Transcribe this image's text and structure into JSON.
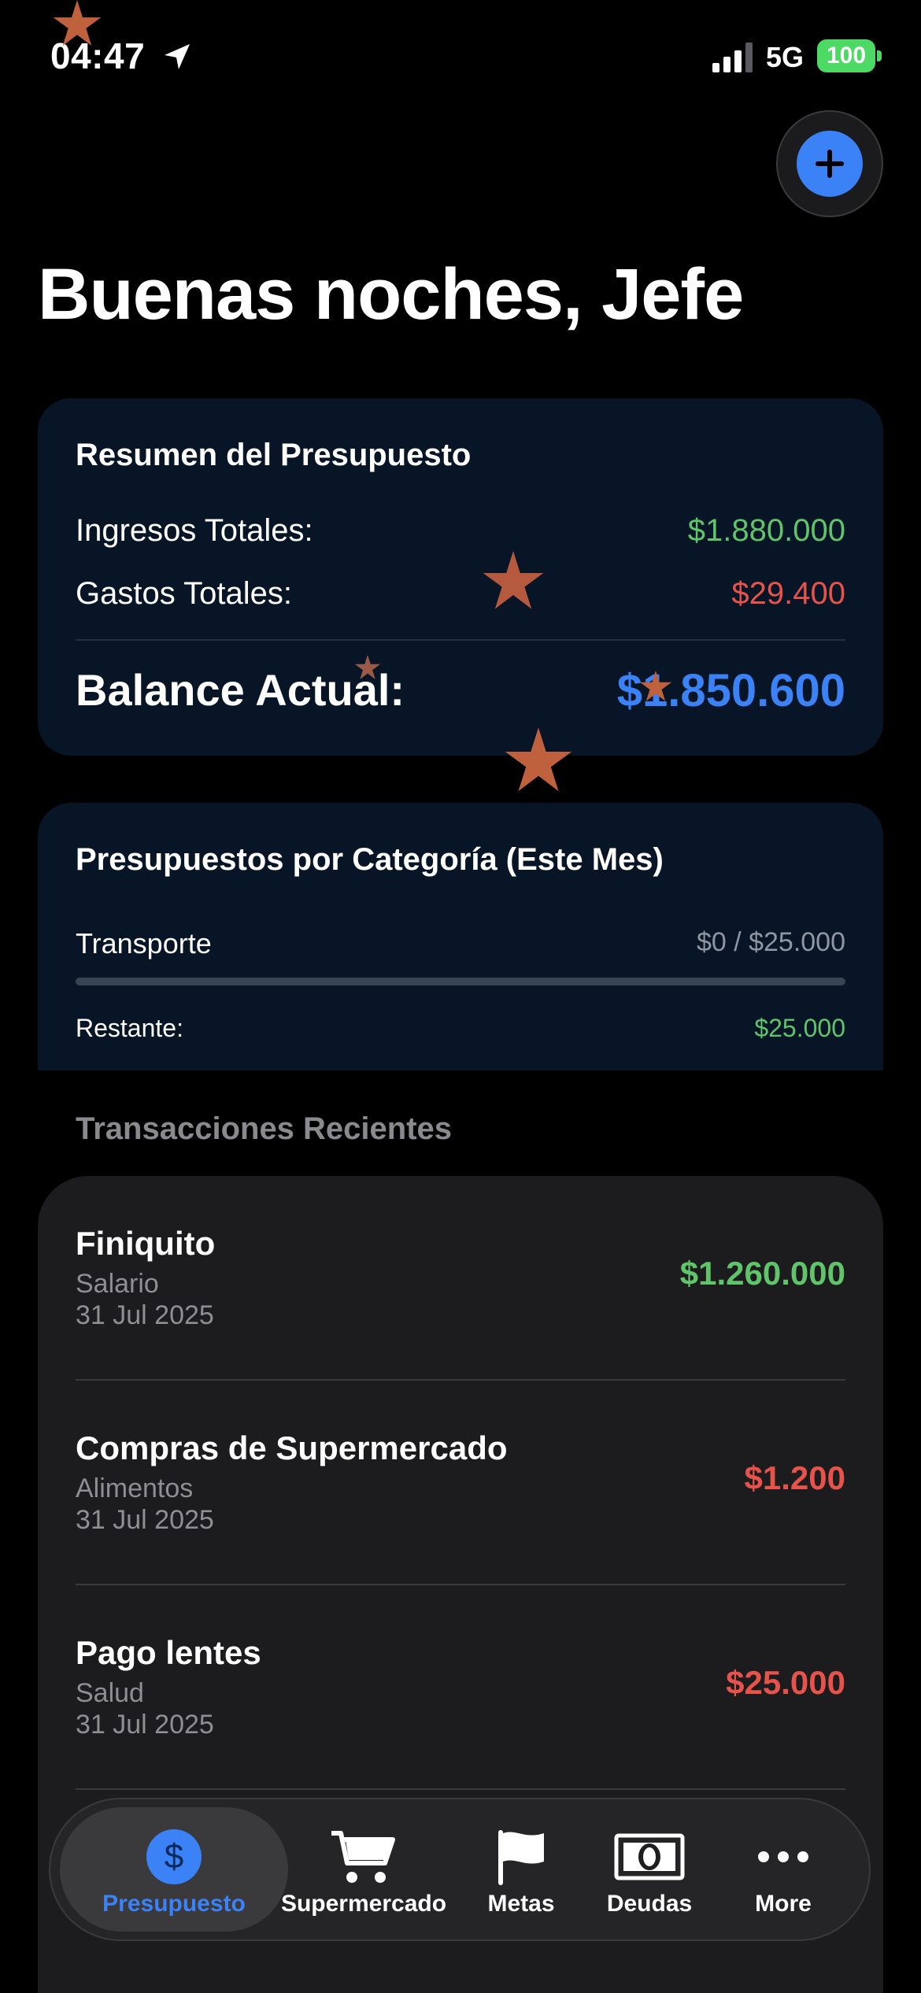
{
  "status_bar": {
    "time": "04:47",
    "network": "5G",
    "battery": "100"
  },
  "header": {
    "greeting": "Buenas noches, Jefe"
  },
  "summary": {
    "title": "Resumen del Presupuesto",
    "income_label": "Ingresos Totales:",
    "income_value": "$1.880.000",
    "expenses_label": "Gastos Totales:",
    "expenses_value": "$29.400",
    "balance_label": "Balance Actual:",
    "balance_value": "$1.850.600"
  },
  "categories": {
    "title": "Presupuestos por Categoría (Este Mes)",
    "items": [
      {
        "name": "Transporte",
        "amount": "$0 / $25.000",
        "progress": 0,
        "remaining_label": "Restante:",
        "remaining_value": "$25.000"
      }
    ]
  },
  "transactions": {
    "header": "Transacciones Recientes",
    "items": [
      {
        "title": "Finiquito",
        "category": "Salario",
        "date": "31 Jul 2025",
        "amount": "$1.260.000",
        "type": "income"
      },
      {
        "title": "Compras de Supermercado",
        "category": "Alimentos",
        "date": "31 Jul 2025",
        "amount": "$1.200",
        "type": "expense"
      },
      {
        "title": "Pago lentes",
        "category": "Salud",
        "date": "31 Jul 2025",
        "amount": "$25.000",
        "type": "expense"
      }
    ]
  },
  "tab_bar": {
    "tabs": [
      {
        "label": "Presupuesto",
        "icon": "dollar-circle-icon",
        "active": true
      },
      {
        "label": "Supermercado",
        "icon": "cart-icon",
        "active": false
      },
      {
        "label": "Metas",
        "icon": "flag-icon",
        "active": false
      },
      {
        "label": "Deudas",
        "icon": "banknote-icon",
        "active": false
      },
      {
        "label": "More",
        "icon": "ellipsis-icon",
        "active": false
      }
    ]
  },
  "colors": {
    "accent": "#3b82f6",
    "income": "#5fc46a",
    "expense": "#e5534b",
    "card_bg": "#081526",
    "overlay_star": "#c0613e"
  }
}
